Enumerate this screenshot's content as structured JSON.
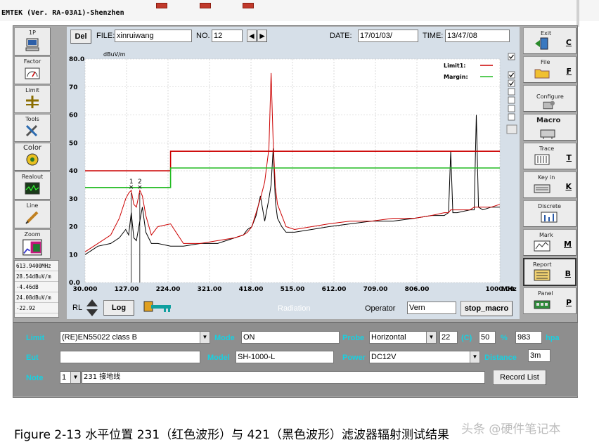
{
  "app": {
    "title": "EMTEK (Ver. RA-03A1)-Shenzhen"
  },
  "left_tools": [
    {
      "label": "1P",
      "icon": "computer-icon"
    },
    {
      "label": "Factor",
      "icon": "meter-icon"
    },
    {
      "label": "Limit",
      "icon": "limit-icon"
    },
    {
      "label": "Tools",
      "icon": "tools-icon"
    },
    {
      "label": "Color",
      "icon": "palette-icon"
    },
    {
      "label": "Realout",
      "icon": "scope-icon"
    },
    {
      "label": "Line",
      "icon": "pen-icon"
    },
    {
      "label": "Zoom",
      "icon": "zoom-icon"
    }
  ],
  "readouts": [
    "613.9400MHz",
    "28.54dBuV/m",
    "-4.46dB",
    "24.08dBuV/m",
    "-22.92"
  ],
  "header": {
    "del_label": "Del",
    "file_label": "FILE:",
    "file_value": "xinruiwang",
    "no_label": "NO.",
    "no_value": "12",
    "date_label": "DATE:",
    "date_value": "17/01/03/",
    "time_label": "TIME:",
    "time_value": "13/47/08"
  },
  "chart_data": {
    "type": "line",
    "ylabel": "dBuV/m",
    "x_unit": "MHz",
    "xlim": [
      30,
      1000
    ],
    "ylim": [
      0,
      80
    ],
    "y_ticks": [
      "80.0",
      "70",
      "60",
      "50",
      "40",
      "30",
      "20",
      "10",
      "0.0"
    ],
    "y_tick_values": [
      80,
      70,
      60,
      50,
      40,
      30,
      20,
      10,
      0
    ],
    "x_ticks": [
      "30.000",
      "127.00",
      "224.00",
      "321.00",
      "418.00",
      "515.00",
      "612.00",
      "709.00",
      "806.00",
      "1000.00"
    ],
    "x_tick_values": [
      30,
      127,
      224,
      321,
      418,
      515,
      612,
      709,
      806,
      1000
    ],
    "grid": true,
    "legend_position": "top-right",
    "legend": [
      {
        "name": "Limit1:",
        "color": "#cc0000"
      },
      {
        "name": "Margin:",
        "color": "#22bb22"
      }
    ],
    "markers": [
      {
        "label": "1",
        "x": 138,
        "y": 33
      },
      {
        "label": "2",
        "x": 158,
        "y": 33
      }
    ],
    "series": [
      {
        "name": "Limit1:",
        "color": "#cc0000",
        "step": true,
        "x": [
          30,
          230,
          230,
          1000
        ],
        "y": [
          40,
          40,
          47,
          47
        ]
      },
      {
        "name": "Margin:",
        "color": "#22bb22",
        "step": true,
        "x": [
          30,
          230,
          230,
          1000
        ],
        "y": [
          34,
          34,
          41,
          41
        ]
      },
      {
        "color": "#000000",
        "x": [
          30,
          60,
          90,
          110,
          125,
          132,
          138,
          144,
          150,
          158,
          164,
          172,
          185,
          200,
          230,
          260,
          300,
          340,
          380,
          400,
          410,
          420,
          430,
          440,
          450,
          460,
          465,
          470,
          475,
          480,
          490,
          500,
          520,
          560,
          600,
          650,
          700,
          750,
          800,
          840,
          870,
          880,
          885,
          890,
          900,
          930,
          940,
          945,
          950,
          960,
          980,
          1000
        ],
        "y": [
          10,
          13,
          14,
          16,
          19,
          17,
          25,
          16,
          15,
          22,
          27,
          18,
          14,
          14,
          13,
          13,
          14,
          14,
          16,
          17,
          19,
          20,
          24,
          31,
          22,
          30,
          35,
          48,
          29,
          23,
          20,
          18,
          18,
          19,
          20,
          21,
          22,
          22,
          23,
          24,
          24,
          25,
          47,
          25,
          25,
          26,
          26,
          60,
          27,
          26,
          27,
          27
        ]
      },
      {
        "color": "#cc0000",
        "x": [
          30,
          60,
          90,
          110,
          125,
          132,
          138,
          144,
          150,
          158,
          164,
          172,
          185,
          200,
          230,
          260,
          300,
          340,
          380,
          400,
          410,
          420,
          430,
          440,
          450,
          460,
          465,
          470,
          475,
          480,
          490,
          500,
          520,
          560,
          600,
          650,
          700,
          750,
          800,
          840,
          870,
          880,
          885,
          890,
          900,
          930,
          940,
          945,
          950,
          960,
          980,
          1000
        ],
        "y": [
          11,
          14,
          17,
          23,
          30,
          32,
          33,
          28,
          27,
          33,
          31,
          24,
          17,
          20,
          21,
          14,
          14,
          15,
          16,
          17,
          18,
          20,
          25,
          30,
          36,
          48,
          75,
          50,
          34,
          28,
          24,
          20,
          19,
          20,
          21,
          22,
          22,
          23,
          23,
          24,
          25,
          25,
          26,
          26,
          26,
          26,
          27,
          27,
          27,
          27,
          27,
          28
        ]
      }
    ]
  },
  "checkboxes": [
    true,
    true,
    true,
    false,
    false,
    false,
    false
  ],
  "bottom_toolbar": {
    "rl_label": "RL",
    "log_label": "Log",
    "radiation_label": "Radiation",
    "operator_label": "Operator",
    "operator_value": "Vern",
    "stop_label": "stop_macro"
  },
  "right_tools": [
    {
      "label": "Exit",
      "key": "C",
      "icon": "exit-icon"
    },
    {
      "label": "File",
      "key": "F",
      "icon": "folder-icon"
    },
    {
      "label": "Configure",
      "key": "",
      "icon": "configure-icon"
    },
    {
      "label": "Macro",
      "key": "",
      "icon": "macro-icon"
    },
    {
      "label": "Trace",
      "key": "T",
      "icon": "trace-icon"
    },
    {
      "label": "Key in",
      "key": "K",
      "icon": "keyboard-icon"
    },
    {
      "label": "Discrete",
      "key": "",
      "icon": "discrete-icon"
    },
    {
      "label": "Mark",
      "key": "M",
      "icon": "mark-icon"
    },
    {
      "label": "Report",
      "key": "B",
      "icon": "report-icon"
    },
    {
      "label": "Panel",
      "key": "P",
      "icon": "panel-icon"
    }
  ],
  "bottom_panel": {
    "limit_label": "Limit",
    "limit_value": "(RE)EN55022 class B",
    "mode_label": "Mode",
    "mode_value": "ON",
    "probe_label": "Probe",
    "probe_value": "Horizontal",
    "temp_value": "22",
    "temp_unit": "(C)",
    "humidity_value": "50",
    "humidity_unit": "%",
    "pressure_value": "983",
    "pressure_unit": "hpa",
    "eut_label": "Eut",
    "eut_value": "",
    "model_label": "Model",
    "model_value": "SH-1000-L",
    "power_label": "Power",
    "power_value": "DC12V",
    "distance_label": "Distance",
    "distance_value": "3m",
    "note_label": "Note",
    "note_select": "1",
    "note_value": "231 接地线",
    "record_label": "Record List"
  },
  "caption": "Figure 2-13  水平位置 231（红色波形）与 421（黑色波形）滤波器辐射测试结果",
  "watermark": "头条 @硬件笔记本"
}
